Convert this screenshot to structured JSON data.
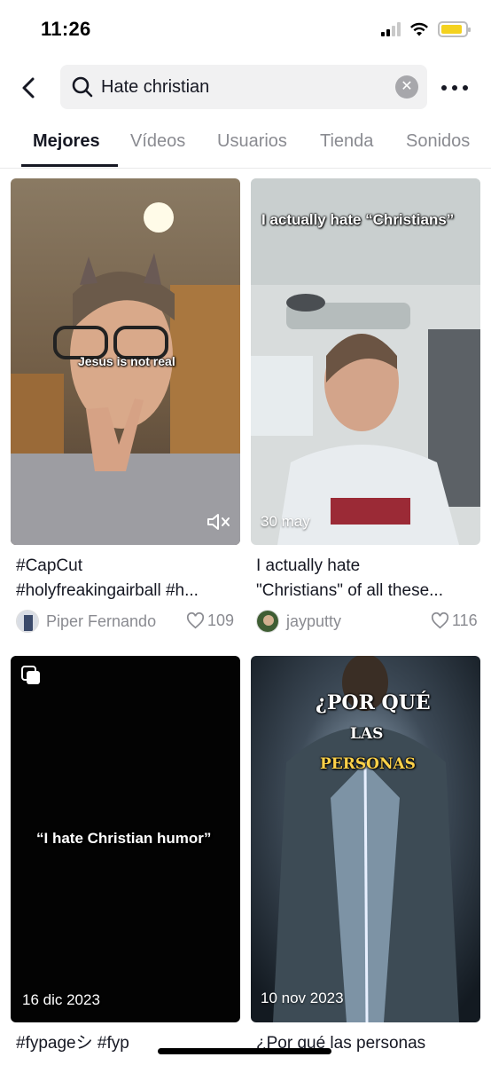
{
  "status_bar": {
    "time": "11:26",
    "battery_level": 0.9
  },
  "search": {
    "query": "Hate christian",
    "back_icon": "chevron-left-icon",
    "search_icon": "search-icon",
    "clear_icon": "clear-icon",
    "more_icon": "more-icon"
  },
  "tabs": [
    {
      "label": "Mejores",
      "active": true
    },
    {
      "label": "Vídeos",
      "active": false
    },
    {
      "label": "Usuarios",
      "active": false
    },
    {
      "label": "Tienda",
      "active": false
    },
    {
      "label": "Sonidos",
      "active": false
    }
  ],
  "results": [
    {
      "overlay_text": "Jesus is not real",
      "caption_line1": "#CapCut",
      "caption_line2": "#holyfreakingairball #h...",
      "author": "Piper Fernando",
      "likes": "109",
      "muted_icon": "muted-speaker-icon"
    },
    {
      "overlay_text": "I actually hate “Christians”",
      "date": "30 may",
      "caption_line1": "I actually hate",
      "caption_line2": "\"Christians\" of all these...",
      "author": "jayputty",
      "likes": "116"
    },
    {
      "overlay_text": "“I hate Christian humor”",
      "date": "16 dic 2023",
      "caption_line1": "#fypageシ #fyp",
      "caption_line2": "",
      "gallery_icon": "multi-photo-icon"
    },
    {
      "overlay_lines": [
        "¿POR QUÉ",
        "LAS",
        "PERSONAS"
      ],
      "date": "10 nov 2023",
      "caption_line1": "¿Por qué las personas",
      "caption_line2": ""
    }
  ],
  "colors": {
    "text": "#161823",
    "muted": "#8a8b91",
    "search_bg": "#f1f1f2",
    "battery": "#f4d21f"
  }
}
